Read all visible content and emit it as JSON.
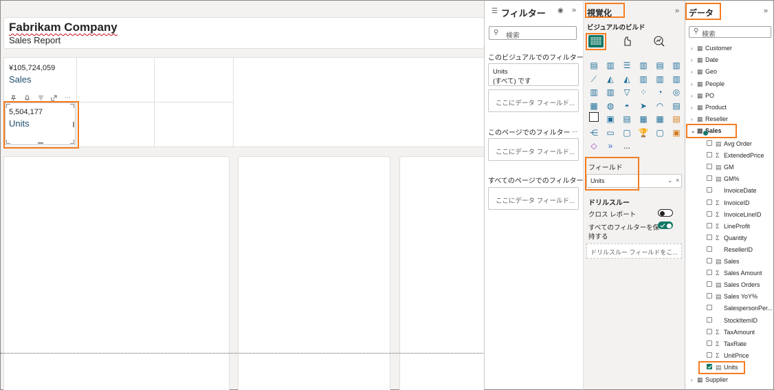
{
  "report": {
    "title": "Fabrikam Company",
    "subtitle": "Sales Report",
    "kpis": [
      {
        "value": "¥105,724,059",
        "label": "Sales"
      },
      {
        "value": "5,504,177",
        "label": "Units"
      }
    ],
    "visual_header_icons": [
      "pin-icon",
      "bell-icon",
      "filter-icon",
      "focus-mode-icon",
      "more-options-icon"
    ]
  },
  "filters": {
    "title": "フィルター",
    "search_placeholder": "検索",
    "visual_section": "このビジュアルでのフィルター...",
    "units_filter_name": "Units",
    "units_filter_value": "(すべて) です",
    "add_field": "ここにデータ フィールド...",
    "page_section": "このページでのフィルター",
    "all_pages_section": "すべてのページでのフィルター...",
    "more": "..."
  },
  "visualizations": {
    "title": "視覚化",
    "build_label": "ビジュアルのビルド",
    "field_label": "フィールド",
    "field_value": "Units",
    "drillthrough_label": "ドリルスルー",
    "cross_report_label": "クロス レポート",
    "keep_filters_label_1": "すべてのフィルターを保",
    "keep_filters_label_2": "持する",
    "drillthrough_placeholder": "ドリルスルー フィールドをこ...",
    "more_visuals": "...",
    "toggles": {
      "cross_report": false,
      "keep_all_filters": true
    },
    "colors": {
      "accent": "#117865",
      "highlight": "#f57c20"
    }
  },
  "data": {
    "title": "データ",
    "search_placeholder": "検索",
    "tables": [
      "Customer",
      "Date",
      "Geo",
      "People",
      "PO",
      "Product",
      "Reseller"
    ],
    "expanded_table": "Sales",
    "fields": [
      {
        "name": "Avg Order",
        "icon": "measure-icon",
        "checked": false
      },
      {
        "name": "ExtendedPrice",
        "icon": "sigma-icon",
        "checked": false
      },
      {
        "name": "GM",
        "icon": "measure-icon",
        "checked": false
      },
      {
        "name": "GM%",
        "icon": "measure-icon",
        "checked": false
      },
      {
        "name": "InvoiceDate",
        "icon": "",
        "checked": false
      },
      {
        "name": "InvoiceID",
        "icon": "sigma-icon",
        "checked": false
      },
      {
        "name": "InvoiceLineID",
        "icon": "sigma-icon",
        "checked": false
      },
      {
        "name": "LineProfit",
        "icon": "sigma-icon",
        "checked": false
      },
      {
        "name": "Quantity",
        "icon": "sigma-icon",
        "checked": false
      },
      {
        "name": "ResellerID",
        "icon": "",
        "checked": false
      },
      {
        "name": "Sales",
        "icon": "measure-icon",
        "checked": false
      },
      {
        "name": "Sales Amount",
        "icon": "sigma-icon",
        "checked": false
      },
      {
        "name": "Sales Orders",
        "icon": "measure-icon",
        "checked": false
      },
      {
        "name": "Sales YoY%",
        "icon": "measure-icon",
        "checked": false
      },
      {
        "name": "SalespersonPer...",
        "icon": "",
        "checked": false
      },
      {
        "name": "StockItemID",
        "icon": "",
        "checked": false
      },
      {
        "name": "TaxAmount",
        "icon": "sigma-icon",
        "checked": false
      },
      {
        "name": "TaxRate",
        "icon": "sigma-icon",
        "checked": false
      },
      {
        "name": "UnitPrice",
        "icon": "sigma-icon",
        "checked": false
      },
      {
        "name": "Units",
        "icon": "measure-icon",
        "checked": true
      }
    ],
    "last_table": "Supplier"
  }
}
